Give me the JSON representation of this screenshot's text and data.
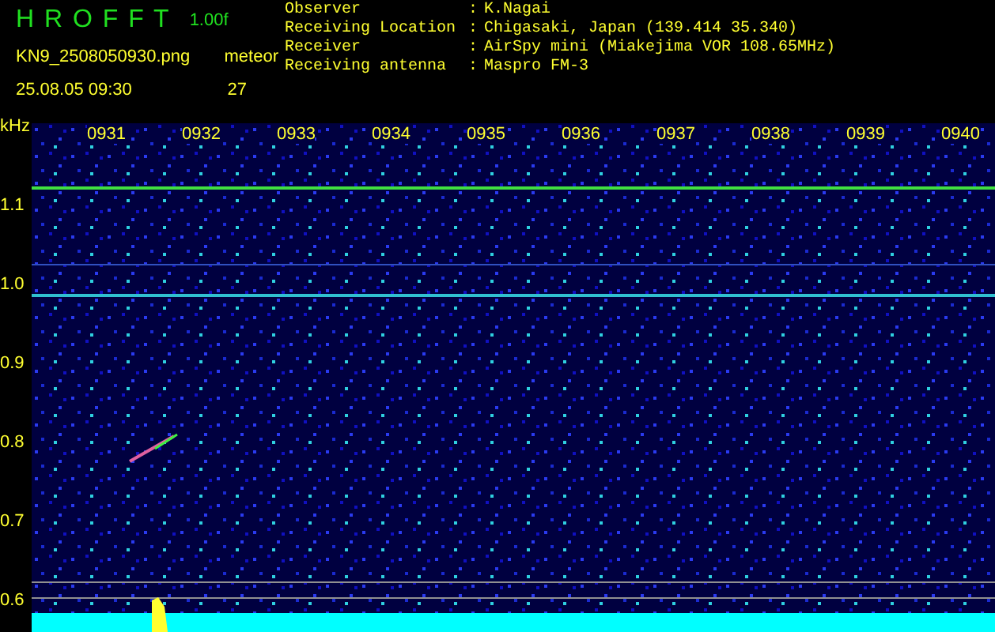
{
  "header": {
    "title": "H R O F F T",
    "version": "1.00f",
    "file": "KN9_2508050930.png",
    "datetime": "25.08.05 09:30",
    "counter_label": "meteor",
    "counter": "27"
  },
  "info": [
    {
      "label": "Observer",
      "sep": ":",
      "value": "K.Nagai"
    },
    {
      "label": "Receiving Location",
      "sep": ":",
      "value": "Chigasaki, Japan (139.414 35.340)"
    },
    {
      "label": "Receiver",
      "sep": ":",
      "value": "AirSpy mini (Miakejima VOR 108.65MHz)"
    },
    {
      "label": "Receiving antenna",
      "sep": ":",
      "value": "Maspro FM-3"
    }
  ],
  "plot": {
    "unit": "kHz",
    "yticks": [
      "1.1",
      "1.0",
      "0.9",
      "0.8",
      "0.7",
      "0.6"
    ],
    "times": [
      "0931",
      "0932",
      "0933",
      "0934",
      "0935",
      "0936",
      "0937",
      "0938",
      "0939",
      "0940"
    ]
  }
}
